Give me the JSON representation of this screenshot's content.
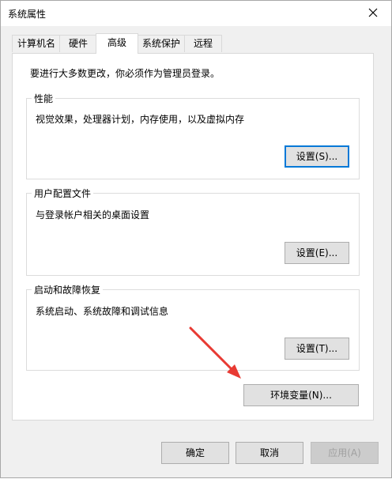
{
  "window": {
    "title": "系统属性"
  },
  "tabs": [
    {
      "label": "计算机名"
    },
    {
      "label": "硬件"
    },
    {
      "label": "高级"
    },
    {
      "label": "系统保护"
    },
    {
      "label": "远程"
    }
  ],
  "active_tab": "高级",
  "panel": {
    "note": "要进行大多数更改，你必须作为管理员登录。",
    "performance": {
      "title": "性能",
      "description": "视觉效果，处理器计划，内存使用，以及虚拟内存",
      "button": "设置(S)..."
    },
    "user_profiles": {
      "title": "用户配置文件",
      "description": "与登录帐户相关的桌面设置",
      "button": "设置(E)..."
    },
    "startup_recovery": {
      "title": "启动和故障恢复",
      "description": "系统启动、系统故障和调试信息",
      "button": "设置(T)..."
    },
    "env_button": "环境变量(N)..."
  },
  "footer": {
    "ok": "确定",
    "cancel": "取消",
    "apply": "应用(A)"
  },
  "colors": {
    "annotation_arrow": "#e83a33",
    "focus": "#0078d7"
  }
}
